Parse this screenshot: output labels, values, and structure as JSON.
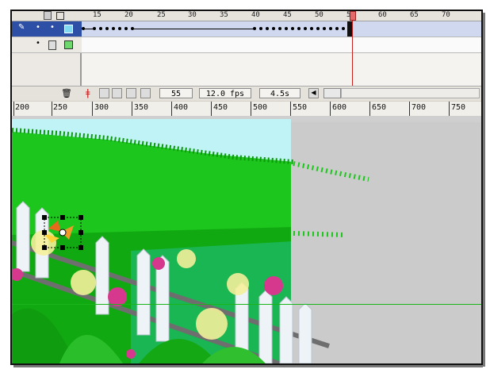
{
  "timeline": {
    "frame_ticks": [
      "15",
      "20",
      "25",
      "30",
      "35",
      "40",
      "45",
      "50",
      "55",
      "60",
      "65",
      "70"
    ],
    "current_frame": "55",
    "frame_rate": "12.0 fps",
    "elapsed_time": "4.5s"
  },
  "ruler": {
    "ticks": [
      "200",
      "250",
      "300",
      "350",
      "400",
      "450",
      "500",
      "550",
      "600",
      "650",
      "700",
      "750"
    ]
  },
  "colors": {
    "sky": "#bff3f6",
    "grass": "#1cc61c",
    "grass_dark": "#0ea20e",
    "fence": "#eef3f8",
    "stage_bg": "#cbcbcb",
    "selection": "#2d4fa6"
  }
}
